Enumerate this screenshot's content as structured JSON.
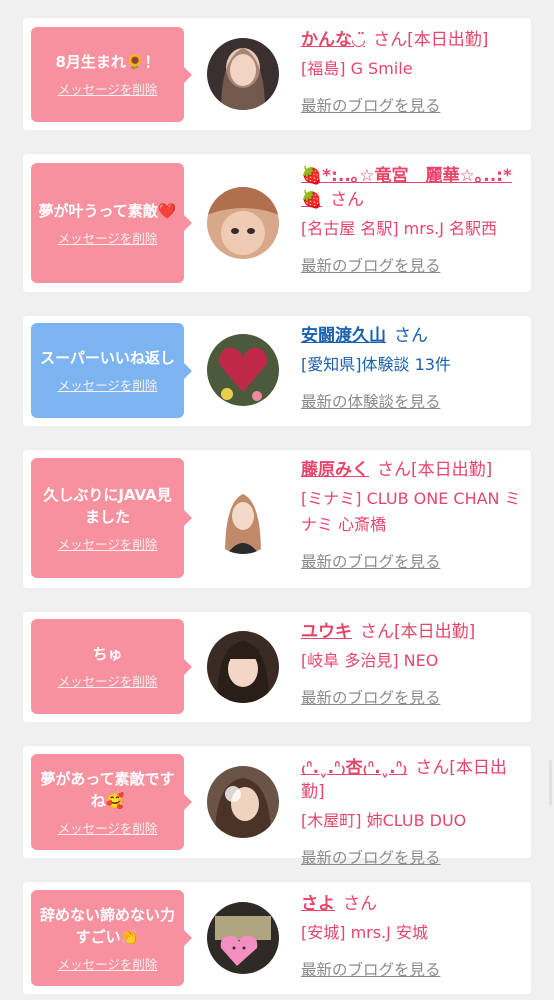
{
  "rows": [
    {
      "message": "8月生まれ🌻！",
      "delete_label": "メッセージを削除",
      "name": "かんな◡̈",
      "honorific": "さん",
      "status": "[本日出勤]",
      "shop": "[福島] G Smile",
      "link": "最新のブログを見る"
    },
    {
      "message": "夢が叶うって素敵❤️",
      "delete_label": "メッセージを削除",
      "name": "🍓*:..｡☆竜宮　麗華☆｡..:*🍓",
      "honorific": "さん",
      "status": "",
      "shop": "[名古屋 名駅] mrs.J 名駅西",
      "link": "最新のブログを見る"
    },
    {
      "message": "スーパーいいね返し",
      "delete_label": "メッセージを削除",
      "name": "安闘渡久山",
      "honorific": "さん",
      "status": "",
      "shop": "[愛知県]体験談 13件",
      "link": "最新の体験談を見る"
    },
    {
      "message": "久しぶりにJAVA見ました",
      "delete_label": "メッセージを削除",
      "name": "藤原みく",
      "honorific": "さん",
      "status": "[本日出勤]",
      "shop": "[ミナミ] CLUB ONE CHAN ミナミ 心斎橋",
      "link": "最新のブログを見る"
    },
    {
      "message": "ちゅ",
      "delete_label": "メッセージを削除",
      "name": "ユウキ",
      "honorific": "さん",
      "status": "[本日出勤]",
      "shop": "[岐阜 多治見] NEO",
      "link": "最新のブログを見る"
    },
    {
      "message": "夢があって素敵ですね🥰",
      "delete_label": "メッセージを削除",
      "name": "₍ᐢ.ˬ.ᐢ₎杏₍ᐢ.ˬ.ᐢ₎",
      "honorific": "さん",
      "status": "[本日出勤]",
      "shop": "[木屋町] 姉CLUB DUO",
      "link": "最新のブログを見る"
    },
    {
      "message": "辞めない諦めない力すごい👏",
      "delete_label": "メッセージを削除",
      "name": "さよ",
      "honorific": "さん",
      "status": "",
      "shop": "[安城] mrs.J 安城",
      "link": "最新のブログを見る"
    }
  ],
  "colors": {
    "pink_bubble": "#f7919f",
    "blue_bubble": "#7cb4f2",
    "name_pink": "#e8456b",
    "name_blue": "#1a5fb0",
    "link_gray": "#8b8b8b"
  }
}
